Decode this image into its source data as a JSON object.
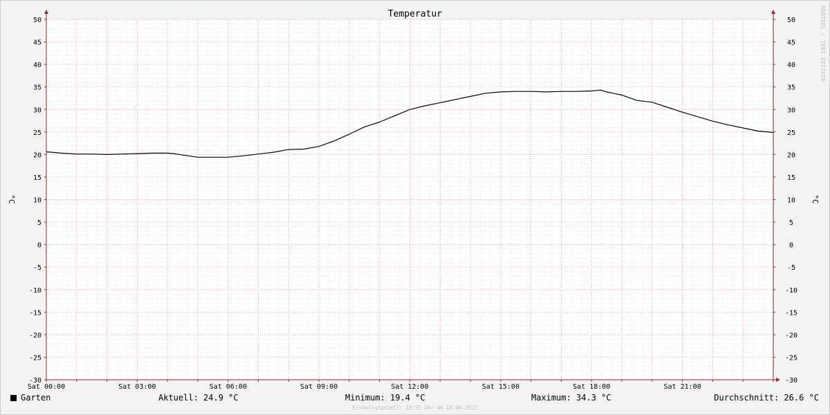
{
  "chart_data": {
    "type": "line",
    "title": "Temperatur",
    "ylabel": "°C",
    "ylabel_right": "°C",
    "ylim": [
      -30,
      50
    ],
    "y_ticks": [
      50,
      45,
      40,
      35,
      30,
      25,
      20,
      15,
      10,
      5,
      0,
      -5,
      -10,
      -15,
      -20,
      -25,
      -30
    ],
    "xlim_hours": [
      0,
      24
    ],
    "x_ticks": [
      {
        "hour": 0,
        "label": "Sat 00:00"
      },
      {
        "hour": 3,
        "label": "Sat 03:00"
      },
      {
        "hour": 6,
        "label": "Sat 06:00"
      },
      {
        "hour": 9,
        "label": "Sat 09:00"
      },
      {
        "hour": 12,
        "label": "Sat 12:00"
      },
      {
        "hour": 15,
        "label": "Sat 15:00"
      },
      {
        "hour": 18,
        "label": "Sat 18:00"
      },
      {
        "hour": 21,
        "label": "Sat 21:00"
      }
    ],
    "grid": true,
    "series": [
      {
        "name": "Garten",
        "color": "#000000",
        "x": [
          0,
          0.5,
          1,
          1.5,
          2,
          2.5,
          3,
          3.5,
          4,
          4.2,
          4.6,
          5,
          5.5,
          6,
          6.5,
          7,
          7.5,
          8,
          8.5,
          9,
          9.5,
          10,
          10.5,
          11,
          11.5,
          12,
          12.5,
          13,
          13.5,
          14,
          14.5,
          15,
          15.5,
          16,
          16.5,
          17,
          17.5,
          18,
          18.3,
          18.5,
          19,
          19.5,
          20,
          20.5,
          21,
          21.5,
          22,
          22.5,
          23,
          23.5,
          24
        ],
        "values": [
          20.6,
          20.3,
          20.1,
          20.1,
          20.0,
          20.1,
          20.2,
          20.3,
          20.3,
          20.2,
          19.8,
          19.4,
          19.4,
          19.4,
          19.7,
          20.1,
          20.5,
          21.1,
          21.2,
          21.8,
          23.0,
          24.5,
          26.1,
          27.2,
          28.6,
          30.0,
          30.8,
          31.5,
          32.2,
          32.9,
          33.6,
          33.9,
          34.0,
          34.0,
          33.9,
          34.0,
          34.0,
          34.1,
          34.3,
          33.9,
          33.2,
          32.0,
          31.6,
          30.5,
          29.4,
          28.4,
          27.4,
          26.6,
          25.9,
          25.2,
          24.9
        ]
      }
    ]
  },
  "legend": {
    "series_name": "Garten",
    "current": "Aktuell: 24.9 °C",
    "minimum": "Minimum: 19.4 °C",
    "maximum": "Maximum: 34.3 °C",
    "average": "Durchschnitt: 26.6 °C"
  },
  "footer": "Erstellungszeit: 23:55 Uhr am 18.06.2022",
  "watermark": "RRDTOOL / TOBI OETIKER",
  "colors": {
    "major_grid": "#e07a9a",
    "minor_grid": "#d6d6d6",
    "axis": "#8a2a2a",
    "background": "#ffffff"
  }
}
